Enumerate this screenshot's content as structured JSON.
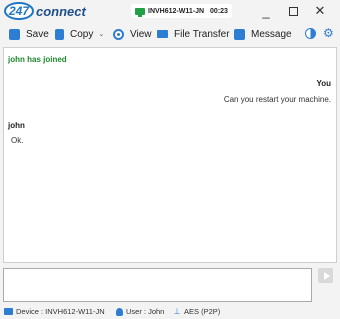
{
  "titlebar": {
    "logo_number": "247",
    "logo_text": "connect",
    "session_name": "INVH612-W11-JN",
    "session_timer": "00:23",
    "minimize": "_",
    "close": "✕"
  },
  "toolbar": {
    "save_label": "Save",
    "copy_label": "Copy",
    "copy_caret": "⌄",
    "view_label": "View",
    "file_transfer_label": "File Transfer",
    "message_label": "Message",
    "settings_glyph": "⚙"
  },
  "chat": {
    "system_message": "john has joined",
    "messages": [
      {
        "sender": "You",
        "text": "Can you restart your machine.",
        "align": "right"
      },
      {
        "sender": "john",
        "text": "Ok.",
        "align": "left"
      }
    ]
  },
  "input": {
    "value": "",
    "placeholder": ""
  },
  "statusbar": {
    "device": "Device : INVH612-W11-JN",
    "user": "User : John",
    "encryption": "AES (P2P)"
  },
  "colors": {
    "accent": "#2d7dd2",
    "system_green": "#1e8a2e",
    "session_green": "#21a045"
  }
}
